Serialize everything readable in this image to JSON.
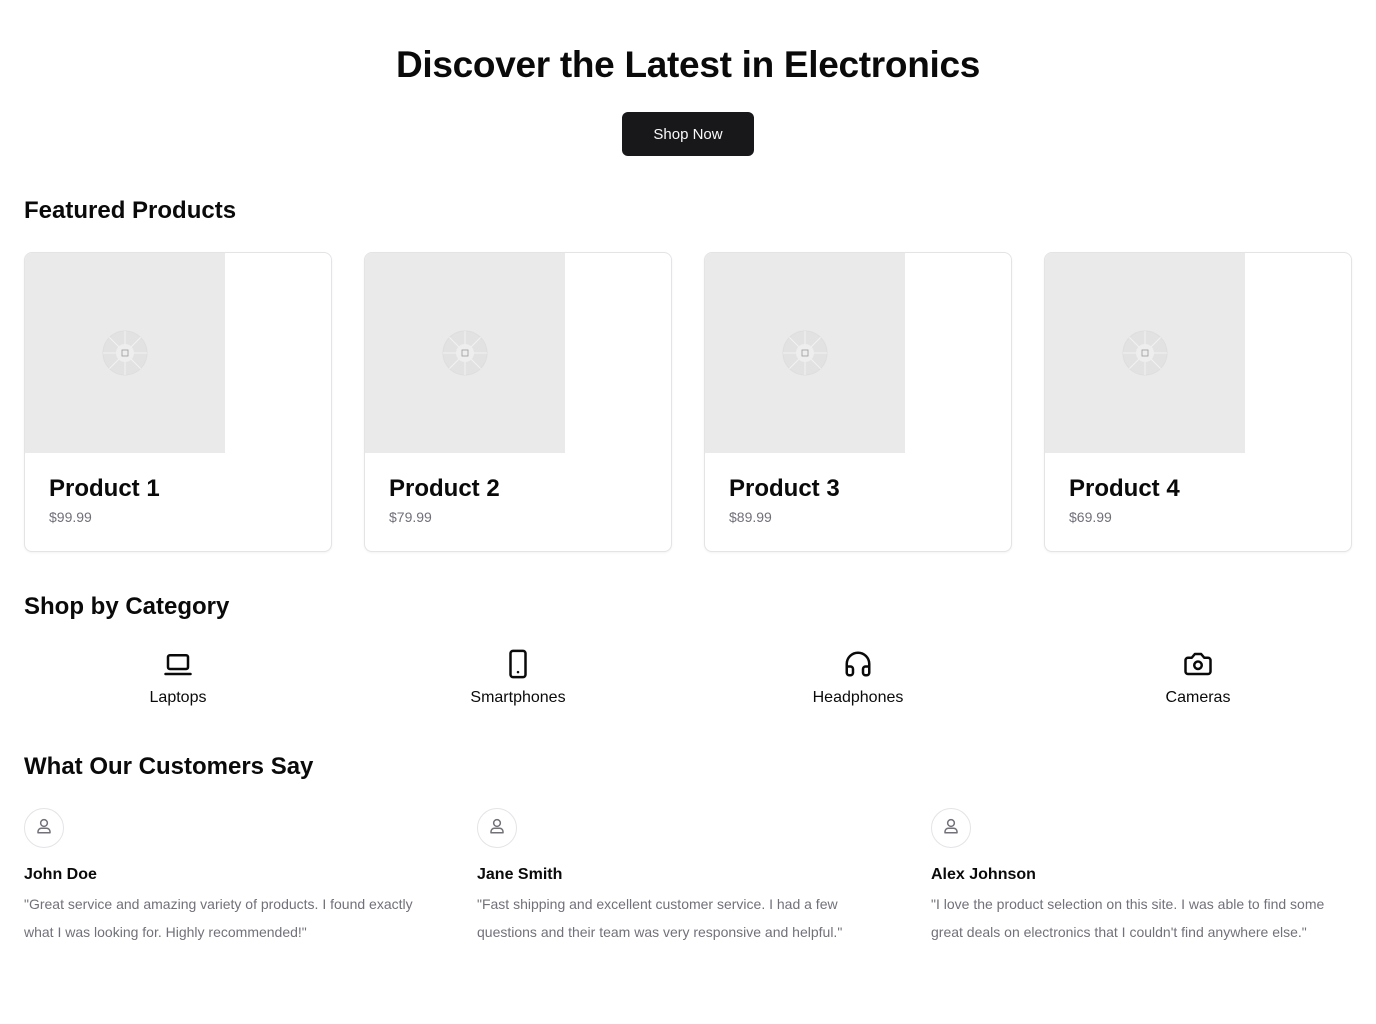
{
  "hero": {
    "title": "Discover the Latest in Electronics",
    "cta_label": "Shop Now"
  },
  "featured": {
    "title": "Featured Products",
    "products": [
      {
        "name": "Product 1",
        "price": "$99.99",
        "image_icon": "image-placeholder-icon"
      },
      {
        "name": "Product 2",
        "price": "$79.99",
        "image_icon": "image-placeholder-icon"
      },
      {
        "name": "Product 3",
        "price": "$89.99",
        "image_icon": "image-placeholder-icon"
      },
      {
        "name": "Product 4",
        "price": "$69.99",
        "image_icon": "image-placeholder-icon"
      }
    ]
  },
  "categories": {
    "title": "Shop by Category",
    "items": [
      {
        "label": "Laptops",
        "icon": "laptop-icon"
      },
      {
        "label": "Smartphones",
        "icon": "smartphone-icon"
      },
      {
        "label": "Headphones",
        "icon": "headphones-icon"
      },
      {
        "label": "Cameras",
        "icon": "camera-icon"
      }
    ]
  },
  "testimonials": {
    "title": "What Our Customers Say",
    "items": [
      {
        "name": "John Doe",
        "quote": "\"Great service and amazing variety of products. I found exactly what I was looking for. Highly recommended!\"",
        "avatar_icon": "user-icon"
      },
      {
        "name": "Jane Smith",
        "quote": "\"Fast shipping and excellent customer service. I had a few questions and their team was very responsive and helpful.\"",
        "avatar_icon": "user-icon"
      },
      {
        "name": "Alex Johnson",
        "quote": "\"I love the product selection on this site. I was able to find some great deals on electronics that I couldn't find anywhere else.\"",
        "avatar_icon": "user-icon"
      }
    ]
  },
  "colors": {
    "primary_button": "#18181b",
    "text": "#0a0a0a",
    "muted_text": "#71717a",
    "border": "#e4e4e7",
    "image_placeholder": "#eaeaea"
  }
}
